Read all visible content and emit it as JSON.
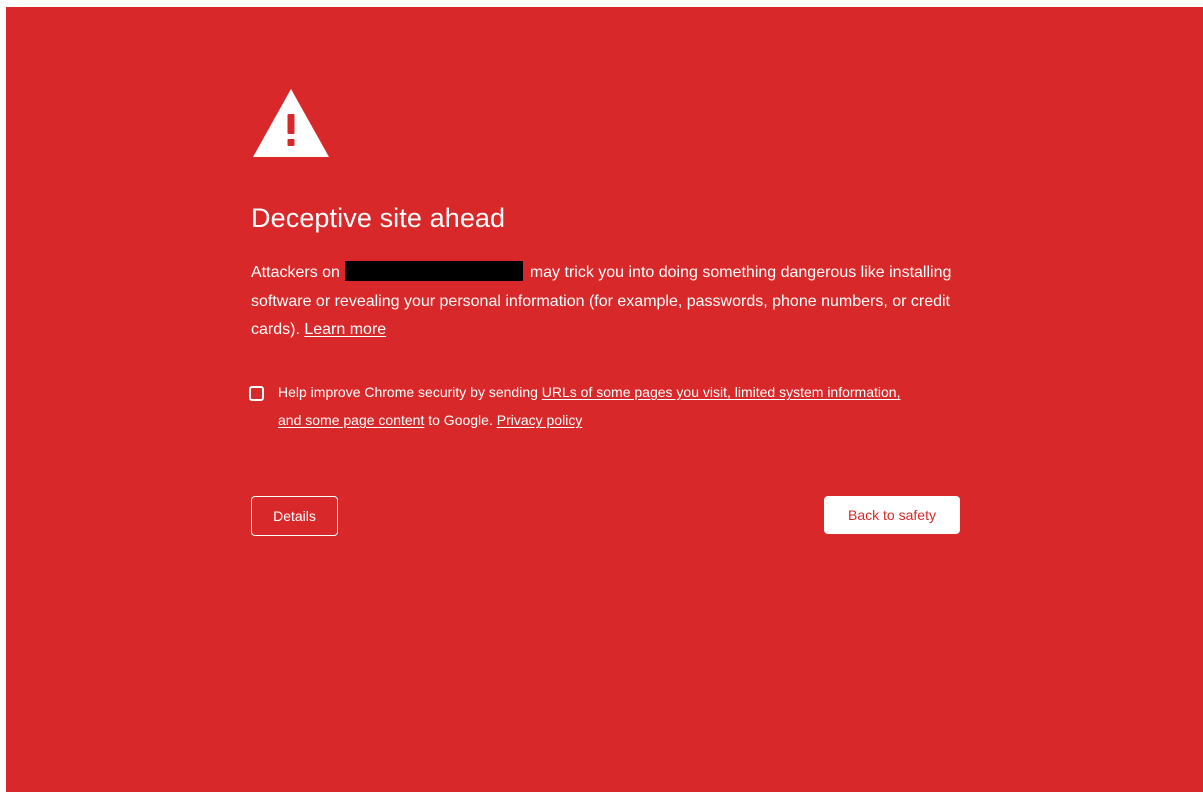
{
  "colors": {
    "background": "#d92829",
    "foreground": "#ffffff",
    "redaction": "#000000"
  },
  "icon": "warning-triangle-icon",
  "title": "Deceptive site ahead",
  "message": {
    "prefix": "Attackers on ",
    "suffix": " may trick you into doing something dangerous like installing software or revealing your personal information (for example, passwords, phone numbers, or credit cards). ",
    "learn_more_label": "Learn more"
  },
  "optin": {
    "checked": false,
    "text_before": "Help improve Chrome security by sending ",
    "link_label": "URLs of some pages you visit, limited system information, and some page content",
    "text_middle": " to Google. ",
    "privacy_label": "Privacy policy"
  },
  "buttons": {
    "details_label": "Details",
    "back_to_safety_label": "Back to safety"
  }
}
